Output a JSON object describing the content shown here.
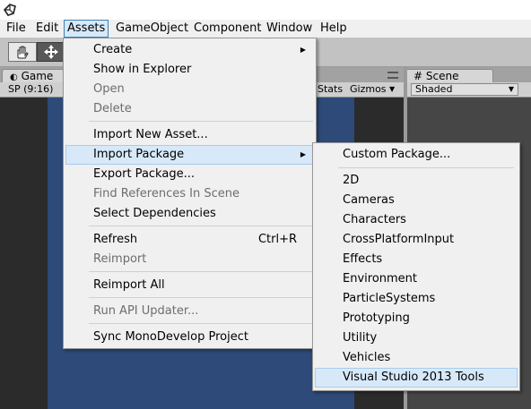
{
  "menubar": {
    "items": [
      "File",
      "Edit",
      "Assets",
      "GameObject",
      "Component",
      "Window",
      "Help"
    ]
  },
  "game_tab": {
    "label": "Game",
    "aspect": "SP (9:16)",
    "stats": "Stats",
    "gizmos": "Gizmos"
  },
  "scene_tab": {
    "label": "# Scene",
    "shading": "Shaded"
  },
  "assets_menu": {
    "create": "Create",
    "show_in_explorer": "Show in Explorer",
    "open": "Open",
    "delete": "Delete",
    "import_new_asset": "Import New Asset...",
    "import_package": "Import Package",
    "export_package": "Export Package...",
    "find_references": "Find References In Scene",
    "select_dependencies": "Select Dependencies",
    "refresh": "Refresh",
    "refresh_shortcut": "Ctrl+R",
    "reimport": "Reimport",
    "reimport_all": "Reimport All",
    "run_api_updater": "Run API Updater...",
    "sync_monodevelop": "Sync MonoDevelop Project"
  },
  "import_package_submenu": {
    "custom_package": "Custom Package...",
    "packages": [
      "2D",
      "Cameras",
      "Characters",
      "CrossPlatformInput",
      "Effects",
      "Environment",
      "ParticleSystems",
      "Prototyping",
      "Utility",
      "Vehicles",
      "Visual Studio 2013 Tools"
    ]
  },
  "colors": {
    "highlight": "#d7e9f9",
    "highlight_border": "#a8cbec",
    "menu_bg": "#f0f0f0",
    "game_bg": "#2d4a78"
  },
  "icons": [
    "unity-logo-icon",
    "hand-tool-icon",
    "move-tool-icon",
    "game-tab-icon",
    "submenu-arrow-icon",
    "dropdown-arrow-icon"
  ]
}
